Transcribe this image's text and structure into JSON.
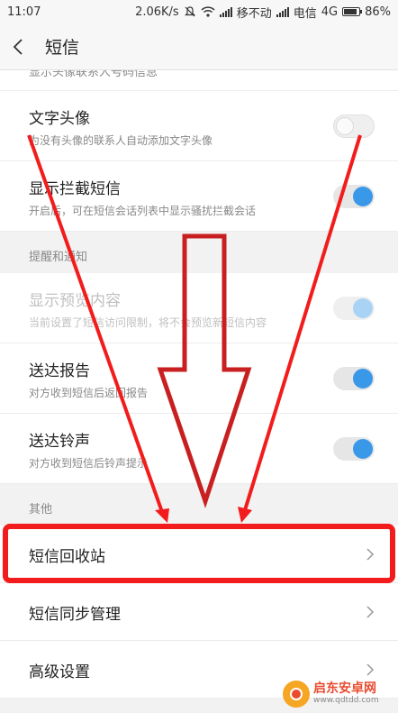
{
  "status_bar": {
    "time": "11:07",
    "speed": "2.06K/s",
    "carrier1": "移不动",
    "carrier2": "电信",
    "network": "4G",
    "battery": "86%"
  },
  "header": {
    "title": "短信"
  },
  "partial_item": "显示头像联系人号码信息",
  "items_top": [
    {
      "title": "文字头像",
      "subtitle": "为没有头像的联系人自动添加文字头像",
      "toggle": "off"
    },
    {
      "title": "显示拦截短信",
      "subtitle": "开启后，可在短信会话列表中显示骚扰拦截会话",
      "toggle": "on"
    }
  ],
  "section_notify": "提醒和通知",
  "items_notify": [
    {
      "title": "显示预览内容",
      "subtitle": "当前设置了短信访问限制，将不会预览新短信内容",
      "toggle": "on",
      "disabled": true
    },
    {
      "title": "送达报告",
      "subtitle": "对方收到短信后返回报告",
      "toggle": "on"
    },
    {
      "title": "送达铃声",
      "subtitle": "对方收到短信后铃声提示",
      "toggle": "on"
    }
  ],
  "section_other": "其他",
  "items_other": [
    {
      "title": "短信回收站"
    },
    {
      "title": "短信同步管理"
    },
    {
      "title": "高级设置"
    }
  ],
  "watermark": {
    "name": "启东安卓网",
    "url": "www.qdtdd.com"
  },
  "colors": {
    "accent": "#3a98e8",
    "annotation": "#f21c1c"
  }
}
